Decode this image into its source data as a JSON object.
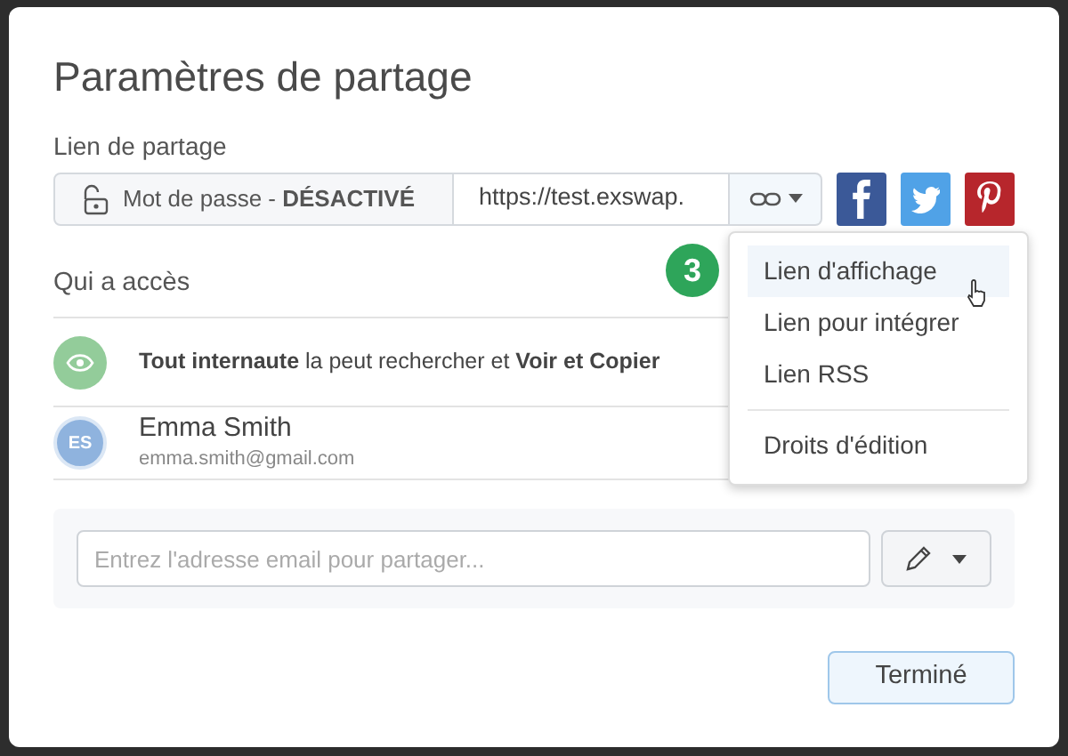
{
  "dialog": {
    "title": "Paramètres de partage"
  },
  "share_link": {
    "label": "Lien de partage",
    "password_label": "Mot de passe - **DÉSACTIVÉ**",
    "url": "https://test.exswap.",
    "social": [
      {
        "kind": "facebook"
      },
      {
        "kind": "twitter"
      },
      {
        "kind": "pinterest"
      }
    ]
  },
  "step_badge": "3",
  "link_menu": {
    "items": [
      {
        "label": "Lien d'affichage",
        "selected": true
      },
      {
        "label": "Lien pour intégrer",
        "selected": false
      },
      {
        "label": "Lien RSS",
        "selected": false
      },
      {
        "label": "Droits d'édition",
        "selected": false,
        "divider_before": true
      }
    ]
  },
  "access": {
    "heading": "Qui a accès",
    "entries": [
      {
        "kind": "public",
        "text": "**Tout internaute** la peut rechercher et **Voir et Copier**"
      },
      {
        "kind": "person",
        "initials": "ES",
        "name": "Emma Smith",
        "email": "emma.smith@gmail.com"
      }
    ]
  },
  "invite": {
    "placeholder": "Entrez l'adresse email pour partager..."
  },
  "done_button": "Terminé"
}
